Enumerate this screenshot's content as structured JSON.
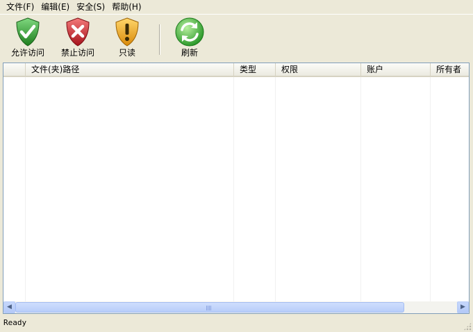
{
  "menu": {
    "items": [
      "文件(F)",
      "编辑(E)",
      "安全(S)",
      "帮助(H)"
    ]
  },
  "toolbar": {
    "allow_label": "允许访问",
    "deny_label": "禁止访问",
    "readonly_label": "只读",
    "refresh_label": "刷新"
  },
  "list": {
    "columns": [
      "文件(夹)路径",
      "类型",
      "权限",
      "账户",
      "所有者"
    ],
    "rows": []
  },
  "status": {
    "text": "Ready"
  },
  "colors": {
    "allow": "#2e9e2e",
    "deny": "#c8202a",
    "readonly": "#f0a91a",
    "refresh": "#3aae3a"
  }
}
